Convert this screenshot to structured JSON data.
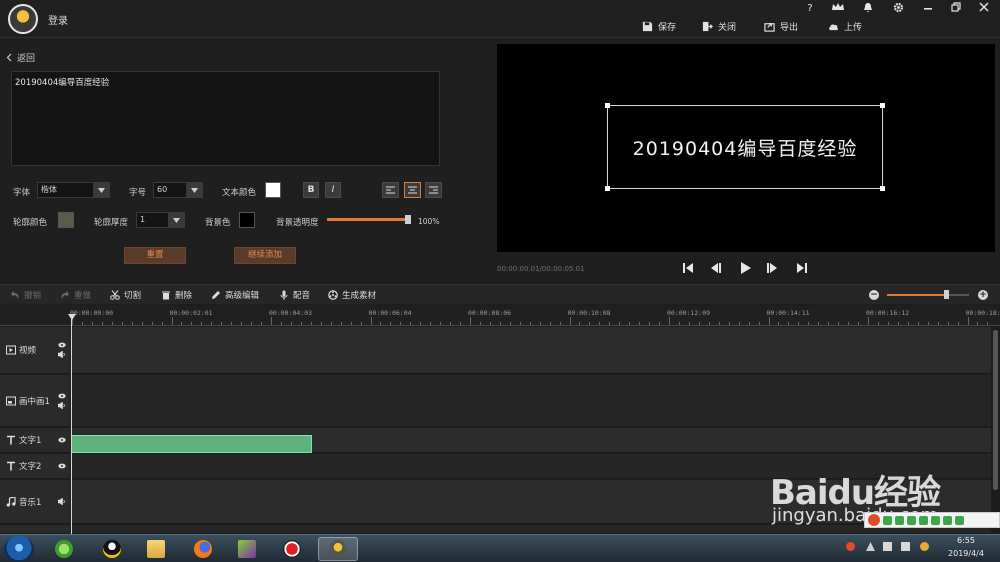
{
  "titlebar": {
    "login": "登录",
    "help": "?",
    "vip": "VIP",
    "actions": {
      "save": "保存",
      "close": "关闭",
      "export": "导出",
      "upload": "上传"
    }
  },
  "editor": {
    "back": "返回",
    "text_value": "20190404编导百度经验",
    "font_label": "字体",
    "font_value": "楷体",
    "size_label": "字号",
    "size_value": "60",
    "text_color_label": "文本颜色",
    "text_color": "#ffffff",
    "bold": "B",
    "italic": "I",
    "outline_color_label": "轮廓颜色",
    "outline_color": "#5b5b4a",
    "outline_thickness_label": "轮廓厚度",
    "outline_thickness_value": "1",
    "bg_color_label": "背景色",
    "bg_color": "#000000",
    "bg_opacity_label": "背景透明度",
    "bg_opacity_value": "100%",
    "bg_opacity_fraction": 1.0,
    "reset_button": "重置",
    "continue_button": "继续添加"
  },
  "preview": {
    "caption": "20190404编导百度经验",
    "time": "00:00:00.01/00:00:05.01"
  },
  "toolbar": {
    "undo": "撤销",
    "redo": "重做",
    "cut": "切割",
    "delete": "删除",
    "advanced": "高级编辑",
    "dub": "配音",
    "generate": "生成素材",
    "zoom_fraction": 0.73
  },
  "ruler": {
    "ticks": [
      "00:00:00:00",
      "00:00:02:01",
      "00:00:04:03",
      "00:00:06:04",
      "00:00:08:06",
      "00:00:10:08",
      "00:00:12:09",
      "00:00:14:11",
      "00:00:16:12",
      "00:00:18:"
    ]
  },
  "tracks": {
    "video": "视频",
    "pip": "画中画1",
    "text1": "文字1",
    "text2": "文字2",
    "music": "音乐1"
  },
  "taskbar": {
    "time": "6:55",
    "date": "2019/4/4"
  },
  "watermark": {
    "brand": "Baidu经验",
    "url": "jingyan.baidu.com"
  },
  "colors": {
    "accent": "#e07a3b",
    "clip": "#5fb37a"
  }
}
